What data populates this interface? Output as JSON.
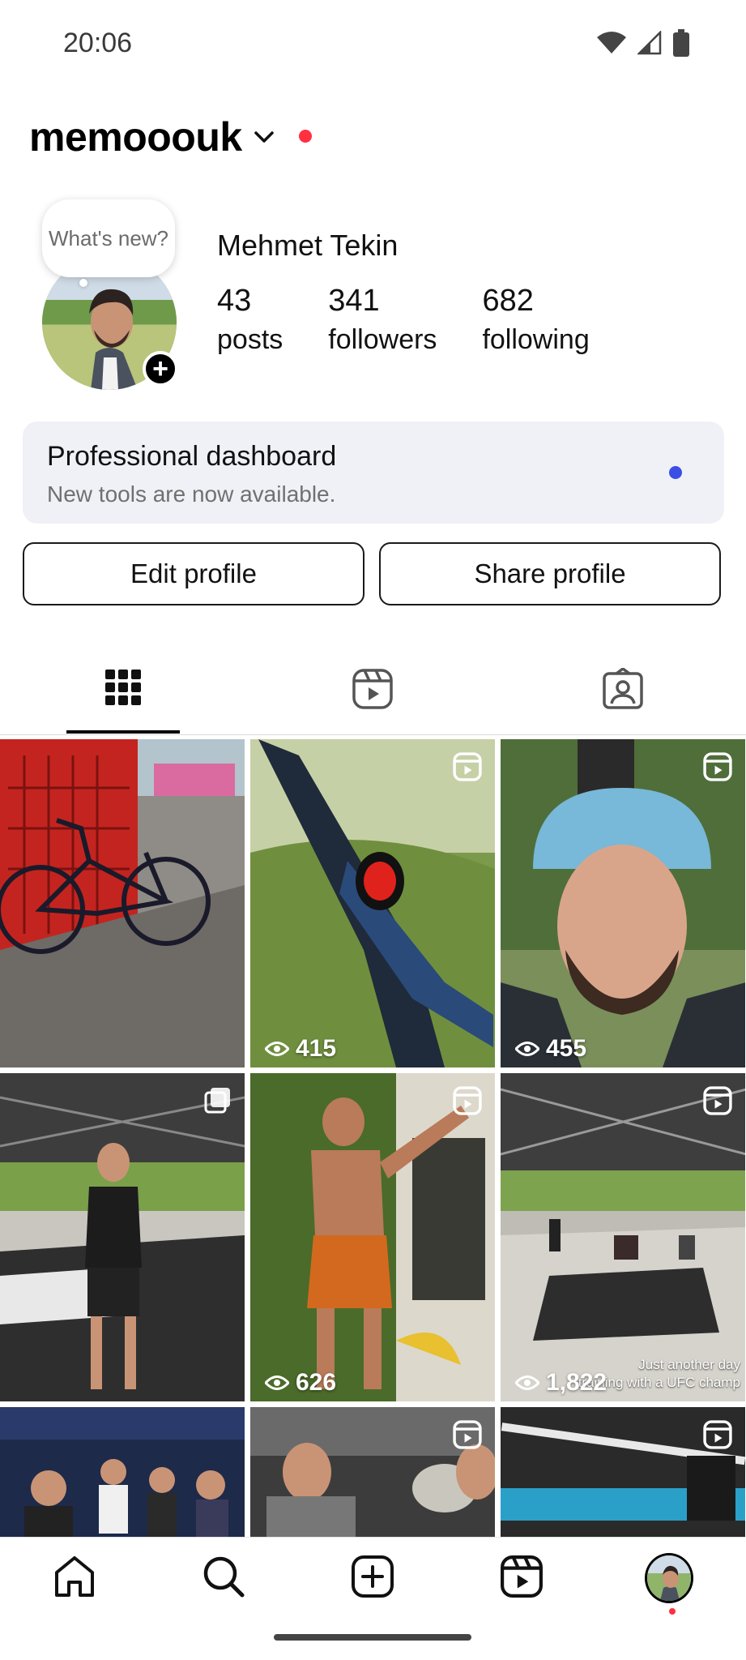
{
  "status_bar": {
    "time": "20:06",
    "icons": [
      "wifi-icon",
      "signal-icon",
      "battery-icon"
    ]
  },
  "header": {
    "username": "memooouk"
  },
  "profile": {
    "note_bubble": "What's new?",
    "full_name": "Mehmet Tekin",
    "stats": [
      {
        "value": "43",
        "label": "posts"
      },
      {
        "value": "341",
        "label": "followers"
      },
      {
        "value": "682",
        "label": "following"
      }
    ]
  },
  "dashboard": {
    "title": "Professional dashboard",
    "subtitle": "New tools are now available."
  },
  "buttons": {
    "edit": "Edit profile",
    "share": "Share profile"
  },
  "tabs": [
    "grid-icon",
    "reels-icon",
    "tagged-icon"
  ],
  "grid": [
    {
      "type": "photo",
      "views": ""
    },
    {
      "type": "reel",
      "views": "415"
    },
    {
      "type": "reel",
      "views": "455"
    },
    {
      "type": "carousel",
      "views": ""
    },
    {
      "type": "reel",
      "views": "626"
    },
    {
      "type": "reel",
      "views": "1,822",
      "caption_line1": "Just another day",
      "caption_line2": "training with a UFC champ"
    },
    {
      "type": "photo",
      "views": ""
    },
    {
      "type": "reel",
      "views": ""
    },
    {
      "type": "reel",
      "views": ""
    }
  ],
  "bottom_nav": [
    "home-icon",
    "search-icon",
    "create-icon",
    "reels-icon",
    "profile-avatar"
  ],
  "colors": {
    "accent_red": "#ff3040",
    "dashboard_bg": "#eff1f6",
    "dashboard_dot": "#3b4fe4"
  }
}
